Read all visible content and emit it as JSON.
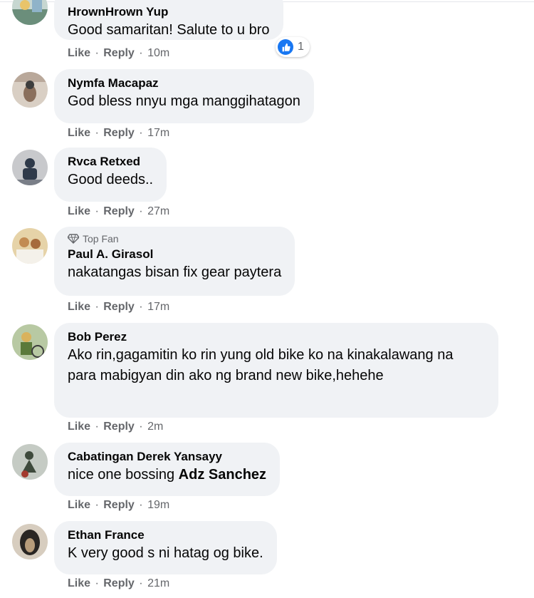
{
  "comments": [
    {
      "author": "HrownHrown Yup",
      "badge": "",
      "text": "Good samaritan! Salute to u bro",
      "mention": "",
      "like": "Like",
      "reply": "Reply",
      "time": "10m",
      "reaction_count": "1",
      "avatar_colors": [
        "#c7d7d1",
        "#6b8e7b",
        "#e9c46a"
      ]
    },
    {
      "author": "Nymfa Macapaz",
      "text": "God bless nnyu mga manggihatagon",
      "like": "Like",
      "reply": "Reply",
      "time": "17m",
      "avatar_colors": [
        "#d9cfc4",
        "#8a6f5c",
        "#3d3d3d"
      ]
    },
    {
      "author": "Rvca Retxed",
      "text": "Good deeds..",
      "like": "Like",
      "reply": "Reply",
      "time": "27m",
      "avatar_colors": [
        "#c8c9cc",
        "#2f3a4a",
        "#7a7f88"
      ]
    },
    {
      "author": "Paul A. Girasol",
      "badge": "Top Fan",
      "text": "nakatangas bisan fix gear paytera",
      "like": "Like",
      "reply": "Reply",
      "time": "17m",
      "avatar_colors": [
        "#e6d3a8",
        "#c28b52",
        "#f4f1ea"
      ]
    },
    {
      "author": "Bob Perez",
      "text": "Ako rin,gagamitin ko rin yung old bike ko na kinakalawang na para mabigyan din ako ng brand new bike,hehehe",
      "like": "Like",
      "reply": "Reply",
      "time": "2m",
      "avatar_colors": [
        "#b8c9a3",
        "#5b7a3a",
        "#d9b25c"
      ]
    },
    {
      "author": "Cabatingan Derek Yansayy",
      "text": "nice one bossing ",
      "mention": "Adz Sanchez",
      "like": "Like",
      "reply": "Reply",
      "time": "19m",
      "avatar_colors": [
        "#c5cbc4",
        "#3e4a3c",
        "#a33a2e"
      ]
    },
    {
      "author": "Ethan France",
      "text": "K very good s ni hatag og bike.",
      "like": "Like",
      "reply": "Reply",
      "time": "21m",
      "avatar_colors": [
        "#d7cdbf",
        "#2a2623",
        "#b89c7a"
      ]
    }
  ],
  "separator": "·"
}
